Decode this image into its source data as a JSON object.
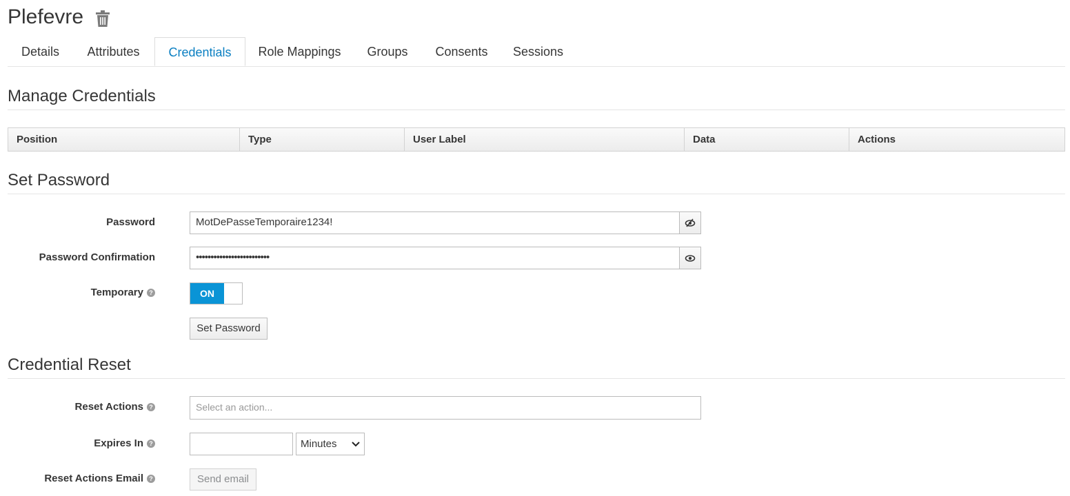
{
  "header": {
    "user_name": "Plefevre"
  },
  "tabs": [
    {
      "label": "Details"
    },
    {
      "label": "Attributes"
    },
    {
      "label": "Credentials",
      "active": true
    },
    {
      "label": "Role Mappings"
    },
    {
      "label": "Groups"
    },
    {
      "label": "Consents"
    },
    {
      "label": "Sessions"
    }
  ],
  "manage_credentials": {
    "title": "Manage Credentials",
    "columns": [
      "Position",
      "Type",
      "User Label",
      "Data",
      "Actions"
    ]
  },
  "set_password": {
    "title": "Set Password",
    "password_label": "Password",
    "password_value": "MotDePasseTemporaire1234!",
    "confirm_label": "Password Confirmation",
    "confirm_value": "•••••••••••••••••••••••••",
    "temporary_label": "Temporary",
    "temporary_toggle": "ON",
    "submit_label": "Set Password"
  },
  "credential_reset": {
    "title": "Credential Reset",
    "reset_actions_label": "Reset Actions",
    "reset_actions_placeholder": "Select an action...",
    "expires_label": "Expires In",
    "expires_value": "",
    "expires_unit": "Minutes",
    "email_label": "Reset Actions Email",
    "send_email_label": "Send email"
  },
  "colors": {
    "accent": "#0a94d6",
    "active_tab": "#0a7fc2"
  }
}
